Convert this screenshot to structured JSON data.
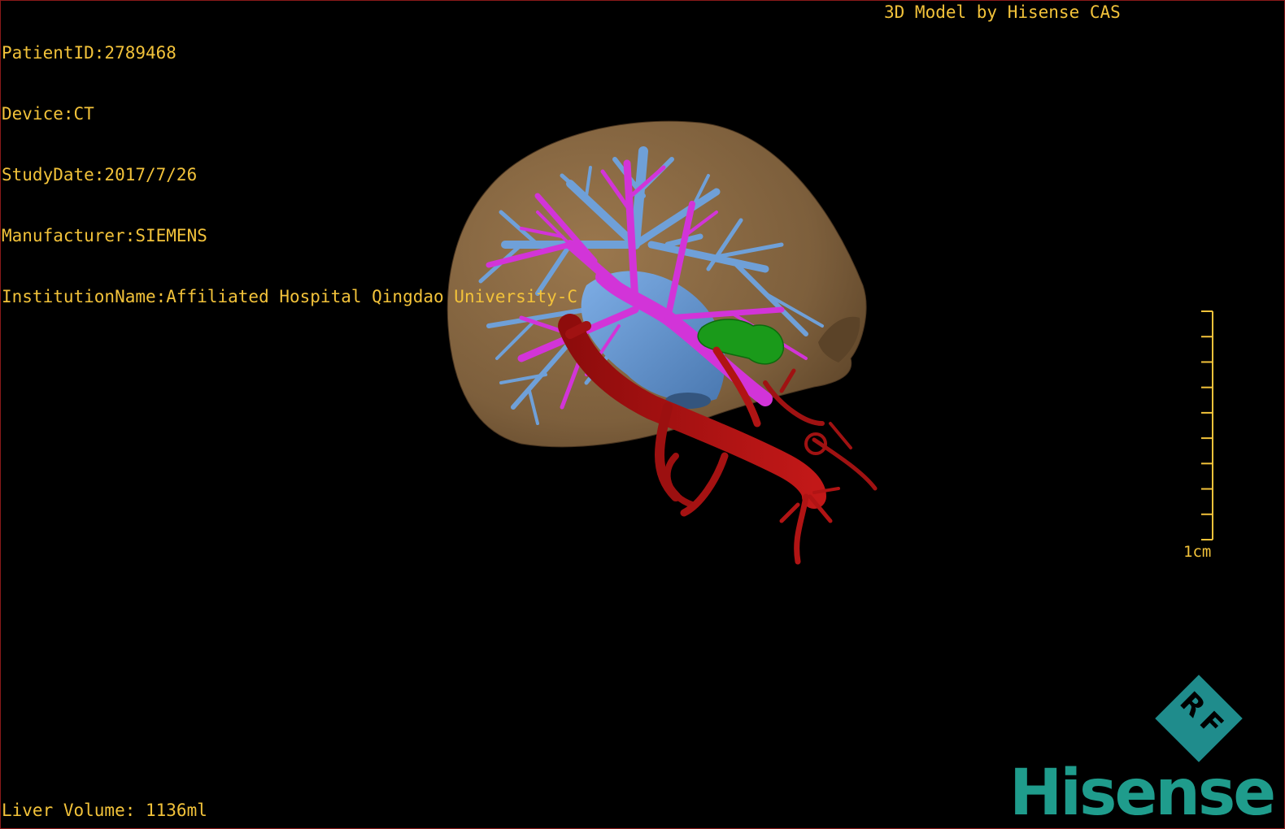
{
  "study_info": {
    "patient_id": "PatientID:2789468",
    "device": "Device:CT",
    "study_date": "StudyDate:2017/7/26",
    "manufacturer": "Manufacturer:SIEMENS",
    "institution": "InstitutionName:Affiliated Hospital Qingdao University-C"
  },
  "header": {
    "model_credit": "3D Model by Hisense CAS"
  },
  "footer": {
    "liver_volume": "Liver Volume: 1136ml"
  },
  "scale_bar": {
    "label": "1cm",
    "ticks": 10
  },
  "logo": {
    "badge_text": "RF",
    "wordmark": "Hisense"
  },
  "colors": {
    "overlay_text": "#f2c23a",
    "liver": "#8a6a45",
    "hepatic_vein": "#6fa0d8",
    "portal_vein": "#d234d8",
    "artery": "#b01010",
    "tumor": "#1a9a1a",
    "brand": "#1f9c8c"
  }
}
